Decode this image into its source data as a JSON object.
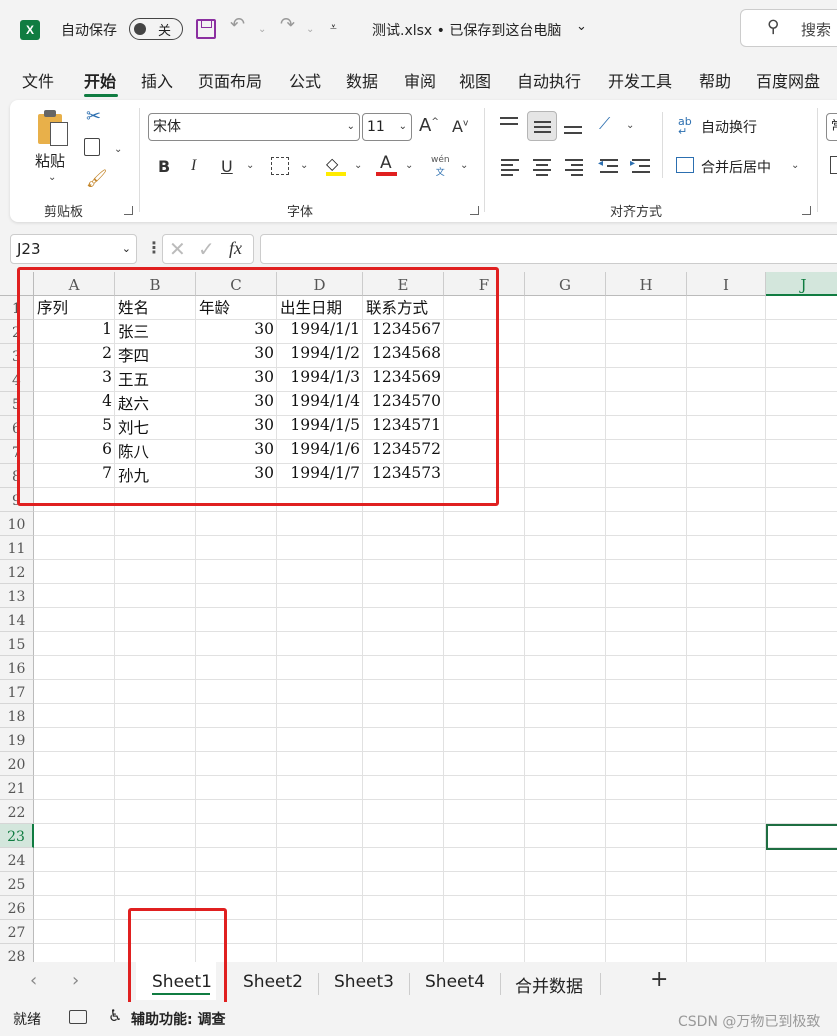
{
  "titlebar": {
    "autosave_label": "自动保存",
    "autosave_state": "关",
    "filename": "测试.xlsx • 已保存到这台电脑",
    "search_placeholder": "搜索"
  },
  "tabs": [
    "文件",
    "开始",
    "插入",
    "页面布局",
    "公式",
    "数据",
    "审阅",
    "视图",
    "自动执行",
    "开发工具",
    "帮助",
    "百度网盘"
  ],
  "active_tab": "开始",
  "ribbon": {
    "clipboard": {
      "paste_label": "粘贴",
      "group_label": "剪贴板"
    },
    "font": {
      "font_name": "宋体",
      "font_size": "11",
      "group_label": "字体",
      "bold": "B",
      "italic": "I",
      "underline": "U",
      "font_color_letter": "A",
      "phonetic_top": "wén",
      "phonetic_bottom": "文",
      "grow": "A",
      "shrink": "A"
    },
    "alignment": {
      "wrap_text": "自动换行",
      "merge_center": "合并后居中",
      "group_label": "对齐方式",
      "wrap_icon_text": "ab"
    },
    "number_partial": "常"
  },
  "formula_bar": {
    "name_box": "J23",
    "fx": "fx",
    "value": ""
  },
  "columns": [
    "A",
    "B",
    "C",
    "D",
    "E",
    "F",
    "G",
    "H",
    "I",
    "J"
  ],
  "rows": [
    "1",
    "2",
    "3",
    "4",
    "5",
    "6",
    "7",
    "8",
    "9",
    "10",
    "11",
    "12",
    "13",
    "14",
    "15",
    "16",
    "17",
    "18",
    "19",
    "20",
    "21",
    "22",
    "23",
    "24",
    "25",
    "26",
    "27",
    "28"
  ],
  "selected_cell": "J23",
  "sheet": {
    "headers": [
      "序列",
      "姓名",
      "年龄",
      "出生日期",
      "联系方式"
    ],
    "data": [
      [
        "1",
        "张三",
        "30",
        "1994/1/1",
        "1234567"
      ],
      [
        "2",
        "李四",
        "30",
        "1994/1/2",
        "1234568"
      ],
      [
        "3",
        "王五",
        "30",
        "1994/1/3",
        "1234569"
      ],
      [
        "4",
        "赵六",
        "30",
        "1994/1/4",
        "1234570"
      ],
      [
        "5",
        "刘七",
        "30",
        "1994/1/5",
        "1234571"
      ],
      [
        "6",
        "陈八",
        "30",
        "1994/1/6",
        "1234572"
      ],
      [
        "7",
        "孙九",
        "30",
        "1994/1/7",
        "1234573"
      ]
    ]
  },
  "sheet_tabs": [
    "Sheet1",
    "Sheet2",
    "Sheet3",
    "Sheet4",
    "合并数据"
  ],
  "active_sheet": "Sheet1",
  "status": {
    "ready": "就绪",
    "accessibility": "辅助功能: 调查",
    "watermark": "CSDN @万物已到极致"
  },
  "colors": {
    "excel_green": "#107c41",
    "annotation_red": "#e02020"
  }
}
